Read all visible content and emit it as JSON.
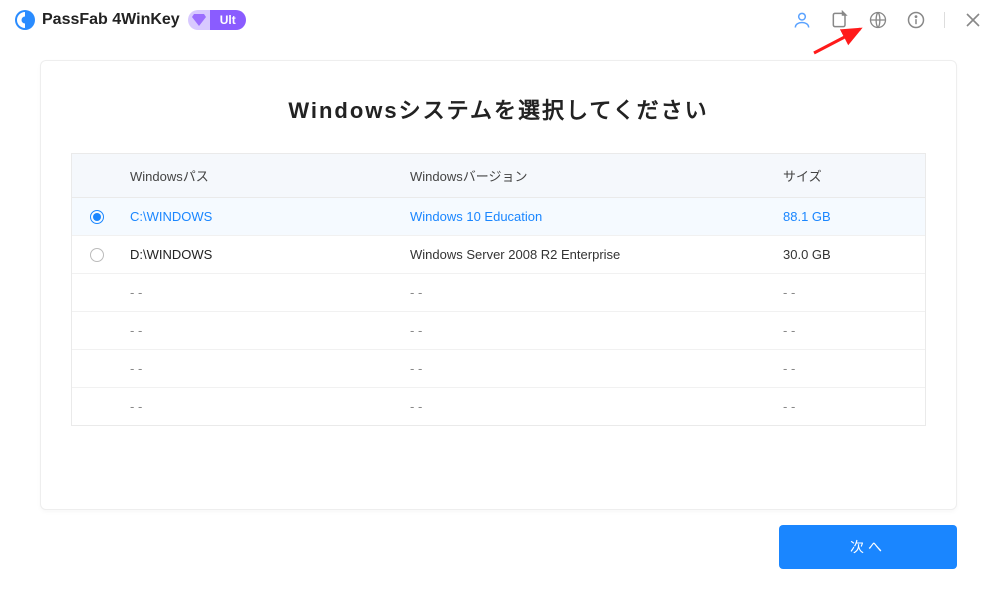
{
  "app": {
    "title": "PassFab 4WinKey",
    "badge_tier": "Ult"
  },
  "page": {
    "title": "Windowsシステムを選択してください",
    "columns": {
      "path": "Windowsパス",
      "version": "Windowsバージョン",
      "size": "サイズ"
    },
    "rows": [
      {
        "selected": true,
        "path": "C:\\WINDOWS",
        "version": "Windows 10 Education",
        "size": "88.1 GB"
      },
      {
        "selected": false,
        "path": "D:\\WINDOWS",
        "version": "Windows Server 2008 R2 Enterprise",
        "size": "30.0 GB"
      },
      {
        "placeholder": true,
        "path": "- -",
        "version": "- -",
        "size": "- -"
      },
      {
        "placeholder": true,
        "path": "- -",
        "version": "- -",
        "size": "- -"
      },
      {
        "placeholder": true,
        "path": "- -",
        "version": "- -",
        "size": "- -"
      },
      {
        "placeholder": true,
        "path": "- -",
        "version": "- -",
        "size": "- -"
      }
    ],
    "next_label": "次へ"
  }
}
